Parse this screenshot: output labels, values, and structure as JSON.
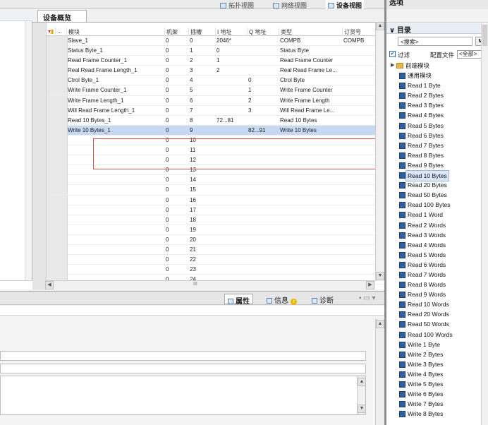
{
  "top_tabs": [
    {
      "label": "拓扑视图"
    },
    {
      "label": "网络视图"
    },
    {
      "label": "设备视图"
    }
  ],
  "overview": {
    "tab_label": "设备概览",
    "columns": [
      "",
      "...",
      "模块",
      "机架",
      "插槽",
      "I 地址",
      "Q 地址",
      "类型",
      "订货号"
    ],
    "rows": [
      {
        "module": "Slave_1",
        "rack": "0",
        "slot": "0",
        "i": "2046*",
        "q": "",
        "type": "COMPB",
        "order": "COMPB",
        "sel": false
      },
      {
        "module": "Status Byte_1",
        "rack": "0",
        "slot": "1",
        "i": "0",
        "q": "",
        "type": "Status Byte",
        "order": "",
        "sel": false
      },
      {
        "module": "Read Frame Counter_1",
        "rack": "0",
        "slot": "2",
        "i": "1",
        "q": "",
        "type": "Read Frame Counter",
        "order": "",
        "sel": false
      },
      {
        "module": "Real Read Frame Length_1",
        "rack": "0",
        "slot": "3",
        "i": "2",
        "q": "",
        "type": "Real Read Frame Le...",
        "order": "",
        "sel": false
      },
      {
        "module": "Ctrol Byte_1",
        "rack": "0",
        "slot": "4",
        "i": "",
        "q": "0",
        "type": "Ctrol Byte",
        "order": "",
        "sel": false
      },
      {
        "module": "Write Frame Counter_1",
        "rack": "0",
        "slot": "5",
        "i": "",
        "q": "1",
        "type": "Write Frame Counter",
        "order": "",
        "sel": false
      },
      {
        "module": "Write Frame Length_1",
        "rack": "0",
        "slot": "6",
        "i": "",
        "q": "2",
        "type": "Write Frame Length",
        "order": "",
        "sel": false
      },
      {
        "module": "Will Read Frame Length_1",
        "rack": "0",
        "slot": "7",
        "i": "",
        "q": "3",
        "type": "Will Read Frame Le...",
        "order": "",
        "sel": false
      },
      {
        "module": "Read 10 Bytes_1",
        "rack": "0",
        "slot": "8",
        "i": "72...81",
        "q": "",
        "type": "Read 10 Bytes",
        "order": "",
        "sel": false
      },
      {
        "module": "Write 10 Bytes_1",
        "rack": "0",
        "slot": "9",
        "i": "",
        "q": "82...91",
        "type": "Write 10 Bytes",
        "order": "",
        "sel": true
      },
      {
        "module": "",
        "rack": "0",
        "slot": "10",
        "i": "",
        "q": "",
        "type": "",
        "order": "",
        "sel": false
      },
      {
        "module": "",
        "rack": "0",
        "slot": "11",
        "i": "",
        "q": "",
        "type": "",
        "order": "",
        "sel": false
      },
      {
        "module": "",
        "rack": "0",
        "slot": "12",
        "i": "",
        "q": "",
        "type": "",
        "order": "",
        "sel": false
      },
      {
        "module": "",
        "rack": "0",
        "slot": "13",
        "i": "",
        "q": "",
        "type": "",
        "order": "",
        "sel": false
      },
      {
        "module": "",
        "rack": "0",
        "slot": "14",
        "i": "",
        "q": "",
        "type": "",
        "order": "",
        "sel": false
      },
      {
        "module": "",
        "rack": "0",
        "slot": "15",
        "i": "",
        "q": "",
        "type": "",
        "order": "",
        "sel": false
      },
      {
        "module": "",
        "rack": "0",
        "slot": "16",
        "i": "",
        "q": "",
        "type": "",
        "order": "",
        "sel": false
      },
      {
        "module": "",
        "rack": "0",
        "slot": "17",
        "i": "",
        "q": "",
        "type": "",
        "order": "",
        "sel": false
      },
      {
        "module": "",
        "rack": "0",
        "slot": "18",
        "i": "",
        "q": "",
        "type": "",
        "order": "",
        "sel": false
      },
      {
        "module": "",
        "rack": "0",
        "slot": "19",
        "i": "",
        "q": "",
        "type": "",
        "order": "",
        "sel": false
      },
      {
        "module": "",
        "rack": "0",
        "slot": "20",
        "i": "",
        "q": "",
        "type": "",
        "order": "",
        "sel": false
      },
      {
        "module": "",
        "rack": "0",
        "slot": "21",
        "i": "",
        "q": "",
        "type": "",
        "order": "",
        "sel": false
      },
      {
        "module": "",
        "rack": "0",
        "slot": "22",
        "i": "",
        "q": "",
        "type": "",
        "order": "",
        "sel": false
      },
      {
        "module": "",
        "rack": "0",
        "slot": "23",
        "i": "",
        "q": "",
        "type": "",
        "order": "",
        "sel": false
      },
      {
        "module": "",
        "rack": "0",
        "slot": "24",
        "i": "",
        "q": "",
        "type": "",
        "order": "",
        "sel": false
      }
    ],
    "hscroll_mid": "III"
  },
  "inspector": {
    "tabs": [
      "属性",
      "信息",
      "诊断"
    ]
  },
  "catalog": {
    "pane_title": "选项",
    "section_title": "目录",
    "search_placeholder": "<搜索>",
    "search_btn": "M",
    "filter_label": "过滤",
    "profile_label": "配置文件",
    "profile_value": "<全部>",
    "items": [
      {
        "label": "前端模块",
        "kind": "folder",
        "level": 0
      },
      {
        "label": "通用模块",
        "kind": "module",
        "level": 1
      },
      {
        "label": "Read 1 Byte",
        "kind": "module",
        "level": 1
      },
      {
        "label": "Read 2 Bytes",
        "kind": "module",
        "level": 1
      },
      {
        "label": "Read 3 Bytes",
        "kind": "module",
        "level": 1
      },
      {
        "label": "Read 4 Bytes",
        "kind": "module",
        "level": 1
      },
      {
        "label": "Read 5 Bytes",
        "kind": "module",
        "level": 1
      },
      {
        "label": "Read 6 Bytes",
        "kind": "module",
        "level": 1
      },
      {
        "label": "Read 7 Bytes",
        "kind": "module",
        "level": 1
      },
      {
        "label": "Read 8 Bytes",
        "kind": "module",
        "level": 1
      },
      {
        "label": "Read 9 Bytes",
        "kind": "module",
        "level": 1
      },
      {
        "label": "Read 10 Bytes",
        "kind": "module",
        "level": 1,
        "highlight": true
      },
      {
        "label": "Read 20 Bytes",
        "kind": "module",
        "level": 1
      },
      {
        "label": "Read 50 Bytes",
        "kind": "module",
        "level": 1
      },
      {
        "label": "Read 100 Bytes",
        "kind": "module",
        "level": 1
      },
      {
        "label": "Read 1 Word",
        "kind": "module",
        "level": 1
      },
      {
        "label": "Read 2 Words",
        "kind": "module",
        "level": 1
      },
      {
        "label": "Read 3 Words",
        "kind": "module",
        "level": 1
      },
      {
        "label": "Read 4 Words",
        "kind": "module",
        "level": 1
      },
      {
        "label": "Read 5 Words",
        "kind": "module",
        "level": 1
      },
      {
        "label": "Read 6 Words",
        "kind": "module",
        "level": 1
      },
      {
        "label": "Read 7 Words",
        "kind": "module",
        "level": 1
      },
      {
        "label": "Read 8 Words",
        "kind": "module",
        "level": 1
      },
      {
        "label": "Read 9 Words",
        "kind": "module",
        "level": 1
      },
      {
        "label": "Read 10 Words",
        "kind": "module",
        "level": 1
      },
      {
        "label": "Read 20 Words",
        "kind": "module",
        "level": 1
      },
      {
        "label": "Read 50 Words",
        "kind": "module",
        "level": 1
      },
      {
        "label": "Read 100 Words",
        "kind": "module",
        "level": 1
      },
      {
        "label": "Write 1 Byte",
        "kind": "module",
        "level": 1
      },
      {
        "label": "Write 2 Bytes",
        "kind": "module",
        "level": 1
      },
      {
        "label": "Write 3 Bytes",
        "kind": "module",
        "level": 1
      },
      {
        "label": "Write 4 Bytes",
        "kind": "module",
        "level": 1
      },
      {
        "label": "Write 5 Bytes",
        "kind": "module",
        "level": 1
      },
      {
        "label": "Write 6 Bytes",
        "kind": "module",
        "level": 1
      },
      {
        "label": "Write 7 Bytes",
        "kind": "module",
        "level": 1
      },
      {
        "label": "Write 8 Bytes",
        "kind": "module",
        "level": 1
      }
    ]
  },
  "colors": {
    "selection": "#c7d8f2",
    "highlight_box": "#d9534f",
    "module_icon": "#2e5f9e"
  }
}
